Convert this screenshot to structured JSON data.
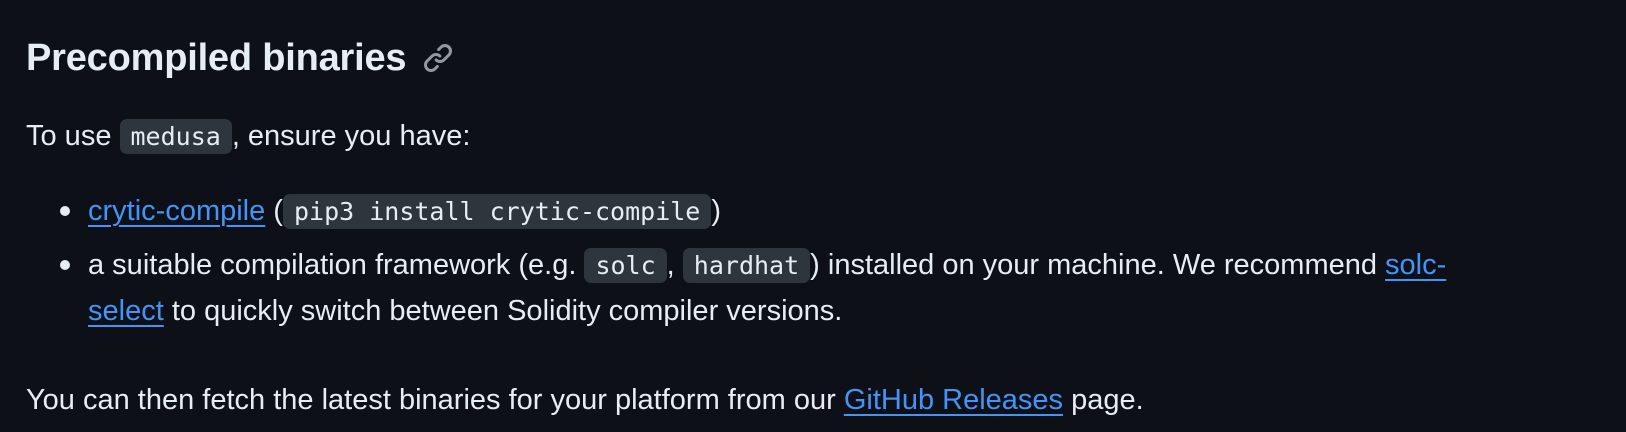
{
  "heading": {
    "title": "Precompiled binaries",
    "anchor_icon": "link-icon"
  },
  "intro": {
    "prefix": "To use ",
    "code": "medusa",
    "suffix": ", ensure you have:"
  },
  "requirements": [
    {
      "link_text": "crytic-compile",
      "open_paren": " (",
      "code": "pip3 install crytic-compile",
      "close_paren": ")"
    },
    {
      "text_a": "a suitable compilation framework (e.g. ",
      "code_a": "solc",
      "sep": ", ",
      "code_b": "hardhat",
      "text_b": ") installed on your machine. We recommend ",
      "link_part1": "solc-",
      "link_part2": "select",
      "text_c": " to quickly switch between Solidity compiler versions."
    }
  ],
  "outro": {
    "prefix": "You can then fetch the latest binaries for your platform from our ",
    "link_text": "GitHub Releases",
    "suffix": " page."
  },
  "colors": {
    "background": "#0d1117",
    "text": "#e6edf3",
    "link": "#4493f8",
    "code_bg": "#2f353d",
    "icon": "#9198a1"
  }
}
